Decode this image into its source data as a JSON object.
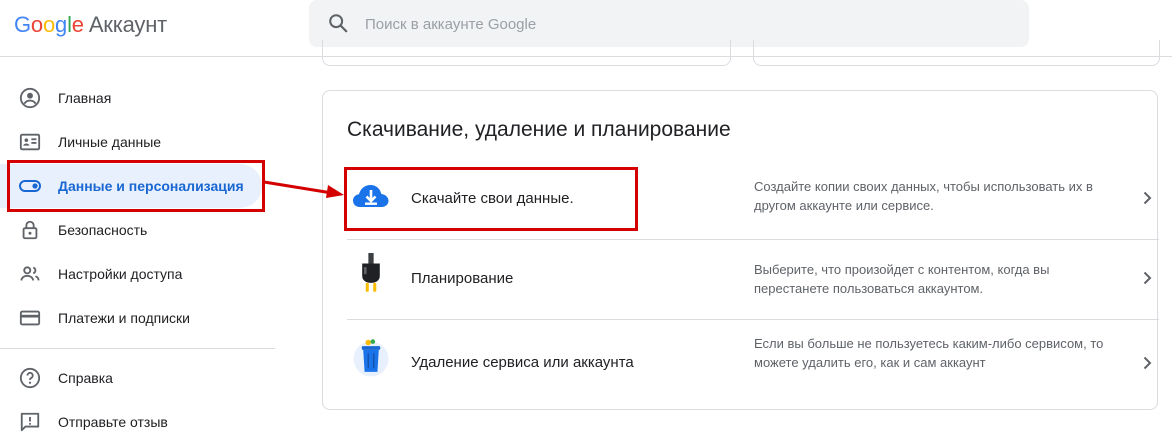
{
  "header": {
    "logo_letters": [
      "G",
      "o",
      "o",
      "g",
      "l",
      "e"
    ],
    "product": "Аккаунт",
    "search_placeholder": "Поиск в аккаунте Google"
  },
  "sidebar": {
    "items": [
      {
        "label": "Главная",
        "icon": "account-circle-icon"
      },
      {
        "label": "Личные данные",
        "icon": "id-card-icon"
      },
      {
        "label": "Данные и персонализация",
        "icon": "toggle-icon",
        "active": true
      },
      {
        "label": "Безопасность",
        "icon": "lock-icon"
      },
      {
        "label": "Настройки доступа",
        "icon": "people-icon"
      },
      {
        "label": "Платежи и подписки",
        "icon": "credit-card-icon"
      },
      {
        "label": "Справка",
        "icon": "help-icon"
      },
      {
        "label": "Отправьте отзыв",
        "icon": "feedback-icon"
      }
    ]
  },
  "section": {
    "title": "Скачивание, удаление и планирование",
    "rows": [
      {
        "label": "Скачайте свои данные.",
        "description": "Создайте копии своих данных, чтобы использовать их в другом аккаунте или сервисе.",
        "icon": "cloud-download-icon"
      },
      {
        "label": "Планирование",
        "description": "Выберите, что произойдет с контентом, когда вы перестанете пользоваться аккаунтом.",
        "icon": "power-plug-icon"
      },
      {
        "label": "Удаление сервиса или аккаунта",
        "description": "Если вы больше не пользуетесь каким-либо сервисом, то можете удалить его, как и сам аккаунт",
        "icon": "trash-bin-icon"
      }
    ]
  },
  "colors": {
    "accent": "#1967d2",
    "active_bg": "#e8f0fe",
    "highlight": "#d40000",
    "divider": "#dadce0"
  }
}
